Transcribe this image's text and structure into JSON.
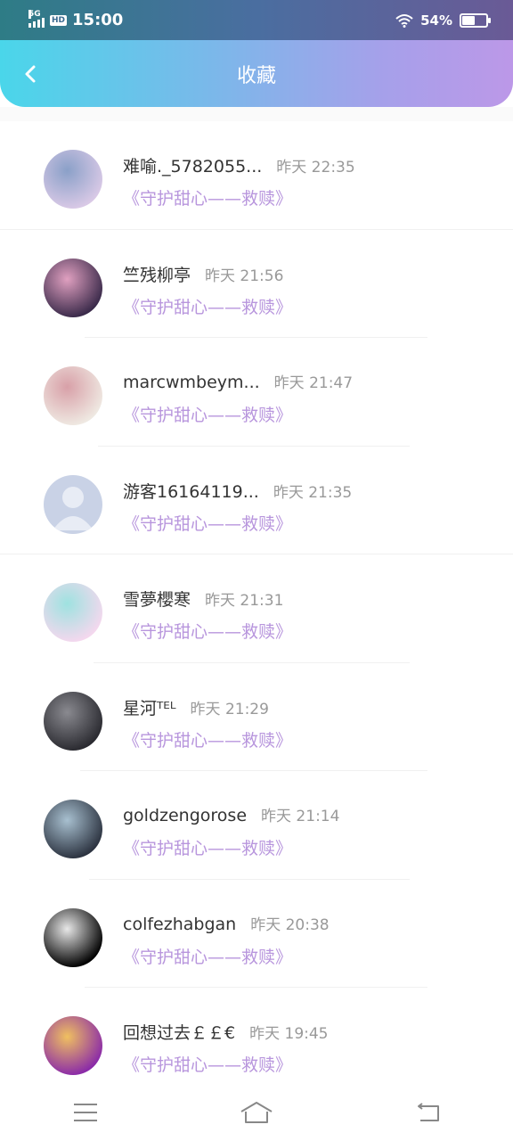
{
  "status_bar": {
    "network": "5G",
    "hd": "HD",
    "time": "15:00",
    "battery_percent": "54%",
    "battery_level": 0.54
  },
  "header": {
    "title": "收藏",
    "back_icon": "chevron-left-icon"
  },
  "items": [
    {
      "name": "难喻._5782055...",
      "time": "昨天 22:35",
      "book": "《守护甜心——救赎》",
      "avatar_colors": [
        "#d9c9e6",
        "#8aa0c8"
      ]
    },
    {
      "name": "竺残柳亭",
      "time": "昨天 21:56",
      "book": "《守护甜心——救赎》",
      "avatar_colors": [
        "#3a2a4a",
        "#e0a0c0"
      ]
    },
    {
      "name": "marcwmbeym...",
      "time": "昨天 21:47",
      "book": "《守护甜心——救赎》",
      "avatar_colors": [
        "#efe9e2",
        "#d8a0a8"
      ]
    },
    {
      "name": "游客16164119...",
      "time": "昨天 21:35",
      "book": "《守护甜心——救赎》",
      "avatar_colors": [
        "#c9d2e6",
        "#e8ecf5"
      ]
    },
    {
      "name": "雪夢櫻寒",
      "time": "昨天 21:31",
      "book": "《守护甜心——救赎》",
      "avatar_colors": [
        "#f4d8ee",
        "#9ee2e0"
      ]
    },
    {
      "name": "星河ᵀᴱᴸ",
      "time": "昨天 21:29",
      "book": "《守护甜心——救赎》",
      "avatar_colors": [
        "#2a2a30",
        "#8a8a90"
      ]
    },
    {
      "name": "goldzengorose",
      "time": "昨天 21:14",
      "book": "《守护甜心——救赎》",
      "avatar_colors": [
        "#2c3340",
        "#a8c0d0"
      ]
    },
    {
      "name": "colfezhabgan",
      "time": "昨天 20:38",
      "book": "《守护甜心——救赎》",
      "avatar_colors": [
        "#000000",
        "#e8e8e8"
      ]
    },
    {
      "name": "回想过去￡￡€",
      "time": "昨天 19:45",
      "book": "《守护甜心——救赎》",
      "avatar_colors": [
        "#8a2aa8",
        "#f0c060"
      ]
    }
  ],
  "nav_bar": {
    "menu_icon": "menu-icon",
    "home_icon": "home-icon",
    "back_icon": "back-icon"
  }
}
